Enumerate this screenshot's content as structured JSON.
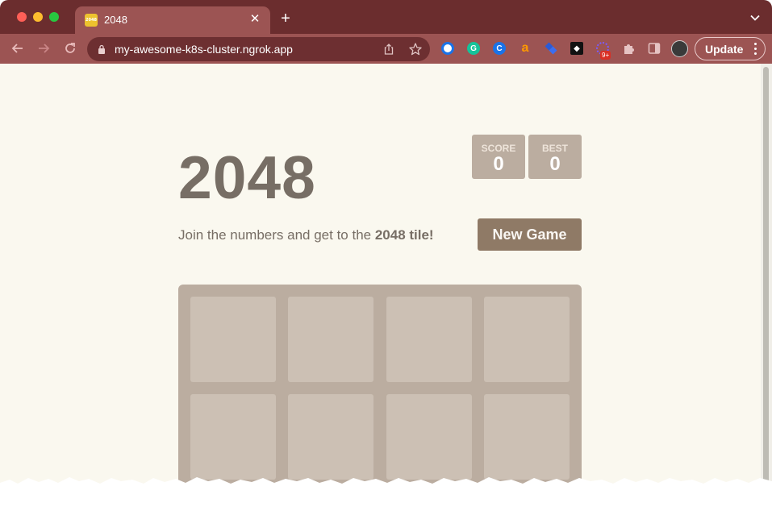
{
  "browser": {
    "tab": {
      "title": "2048",
      "favicon_text": "2048"
    },
    "address_bar": {
      "url": "my-awesome-k8s-cluster.ngrok.app"
    },
    "extensions_badge": "9+",
    "update_label": "Update"
  },
  "game": {
    "title": "2048",
    "score": {
      "label": "SCORE",
      "value": "0"
    },
    "best": {
      "label": "BEST",
      "value": "0"
    },
    "intro_prefix": "Join the numbers and get to the ",
    "intro_bold": "2048 tile!",
    "new_game_label": "New Game",
    "board_rows_visible": 2,
    "board_cols": 4
  },
  "colors": {
    "tabstrip": "#6b2d2e",
    "toolbar": "#9c5453",
    "page_bg": "#faf8ef",
    "board": "#bbada0",
    "button": "#8f7a66",
    "title_text": "#776e65"
  }
}
